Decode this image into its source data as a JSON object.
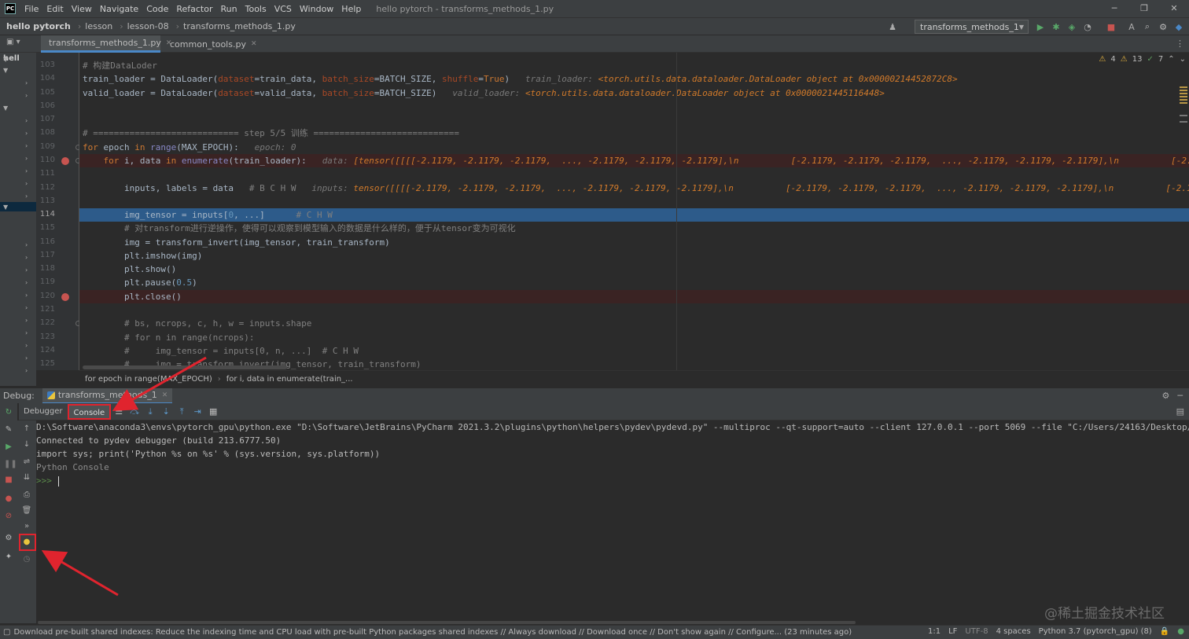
{
  "app": {
    "logo": "PC",
    "window_title": "hello pytorch - transforms_methods_1.py"
  },
  "menu": [
    "File",
    "Edit",
    "View",
    "Navigate",
    "Code",
    "Refactor",
    "Run",
    "Tools",
    "VCS",
    "Window",
    "Help"
  ],
  "window_controls": {
    "minimize": "─",
    "maximize": "❐",
    "close": "✕"
  },
  "breadcrumb_nav": [
    "hello pytorch",
    "lesson",
    "lesson-08",
    "transforms_methods_1.py"
  ],
  "run_config": "transforms_methods_1",
  "tabs": [
    {
      "label": "transforms_methods_1.py",
      "active": true
    },
    {
      "label": "common_tools.py",
      "active": false
    }
  ],
  "project_root": "hell",
  "inspections": {
    "warnings": "4",
    "weak_warnings": "13",
    "ok": "7"
  },
  "code_lines": [
    {
      "num": "103",
      "html": "<span class='cm'># 构建DataLoder</span>"
    },
    {
      "num": "104",
      "html": "train_loader = DataLoader(<span class='pm'>dataset</span>=train_data, <span class='pm'>batch_size</span>=BATCH_SIZE, <span class='pm'>shuffle</span>=<span class='kw'>True</span>)   <span class='hint'>train_loader: </span><span class='hv'>&lt;torch.utils.data.dataloader.DataLoader object at 0x00000214452872C8&gt;</span>"
    },
    {
      "num": "105",
      "html": "valid_loader = DataLoader(<span class='pm'>dataset</span>=valid_data, <span class='pm'>batch_size</span>=BATCH_SIZE)   <span class='hint'>valid_loader: </span><span class='hv'>&lt;torch.utils.data.dataloader.DataLoader object at 0x0000021445116448&gt;</span>"
    },
    {
      "num": "106",
      "html": ""
    },
    {
      "num": "107",
      "html": ""
    },
    {
      "num": "108",
      "html": "<span class='cm'># ============================ step 5/5 训练 ============================</span>"
    },
    {
      "num": "109",
      "html": "<span class='kw'>for</span> epoch <span class='kw'>in</span> <span class='fn'>range</span>(MAX_EPOCH):   <span class='hint'>epoch: 0</span>"
    },
    {
      "num": "110",
      "html": "    <span class='kw'>for</span> i, data <span class='kw'>in</span> <span class='fn'>enumerate</span>(train_loader):   <span class='hint'>data: </span><span class='hv'>[tensor([[[[-2.1179, -2.1179, -2.1179,  ..., -2.1179, -2.1179, -2.1179],\\n          [-2.1179, -2.1179, -2.1179,  ..., -2.1179, -2.1179, -2.1179],\\n          [-2.1179, -2.1179</span>",
      "bp": true
    },
    {
      "num": "111",
      "html": ""
    },
    {
      "num": "112",
      "html": "        inputs, labels = data   <span class='cm'># B C H W</span>   <span class='hint'>inputs: </span><span class='hv'>tensor([[[[-2.1179, -2.1179, -2.1179,  ..., -2.1179, -2.1179, -2.1179],\\n          [-2.1179, -2.1179, -2.1179,  ..., -2.1179, -2.1179, -2.1179],\\n          [-2.1179, -2.117</span>"
    },
    {
      "num": "113",
      "html": ""
    },
    {
      "num": "114",
      "html": "        img_tensor = inputs[<span class='nm'>0</span>, ...]      <span class='cm'># C H W</span>",
      "cur": true
    },
    {
      "num": "115",
      "html": "        <span class='cm'># 对transform进行逆操作，使得可以观察到模型输入的数据是什么样的，便于从tensor变为可视化</span>"
    },
    {
      "num": "116",
      "html": "        img = transform_invert(img_tensor, train_transform)"
    },
    {
      "num": "117",
      "html": "        plt.imshow(img)"
    },
    {
      "num": "118",
      "html": "        plt.show()"
    },
    {
      "num": "119",
      "html": "        plt.pause(<span class='nm'>0.5</span>)"
    },
    {
      "num": "120",
      "html": "        plt.close()",
      "bp": true
    },
    {
      "num": "121",
      "html": ""
    },
    {
      "num": "122",
      "html": "        <span class='cm'># bs, ncrops, c, h, w = inputs.shape</span>"
    },
    {
      "num": "123",
      "html": "        <span class='cm'># for n in range(ncrops):</span>"
    },
    {
      "num": "124",
      "html": "        <span class='cm'>#     img_tensor = inputs[0, n, ...]  # C H W</span>"
    },
    {
      "num": "125",
      "html": "        <span class='cm'>#     img = transform_invert(img_tensor, train_transform)</span>"
    }
  ],
  "editor_breadcrumb": [
    "for epoch in range(MAX_EPOCH)",
    "for i, data in enumerate(train_..."
  ],
  "debug": {
    "label": "Debug:",
    "session_tab": "transforms_methods_1",
    "tabs": [
      "Debugger",
      "Console"
    ]
  },
  "console_lines": [
    "D:\\Software\\anaconda3\\envs\\pytorch_gpu\\python.exe \"D:\\Software\\JetBrains\\PyCharm 2021.3.2\\plugins\\python\\helpers\\pydev\\pydevd.py\" --multiproc --qt-support=auto --client 127.0.0.1 --port 5069 --file \"C:/Users/24163/Desktop/Silver/深入",
    "Connected to pydev debugger (build 213.6777.50)",
    "import sys; print('Python %s on %s' % (sys.version, sys.platform))",
    "Python Console"
  ],
  "console_prompt": ">>>",
  "watermark": "@稀土掘金技术社区",
  "statusbar": {
    "message": "Download pre-built shared indexes: Reduce the indexing time and CPU load with pre-built Python packages shared indexes // Always download // Download once // Don't show again // Configure... (23 minutes ago)",
    "position": "1:1",
    "line_sep": "LF",
    "encoding": "UTF-8",
    "indent": "4 spaces",
    "interpreter": "Python 3.7 (pytorch_gpu) (8)"
  },
  "colors": {
    "accent": "#4a88c7",
    "breakpoint": "#c75450",
    "highlight_box": "#e0242e"
  }
}
